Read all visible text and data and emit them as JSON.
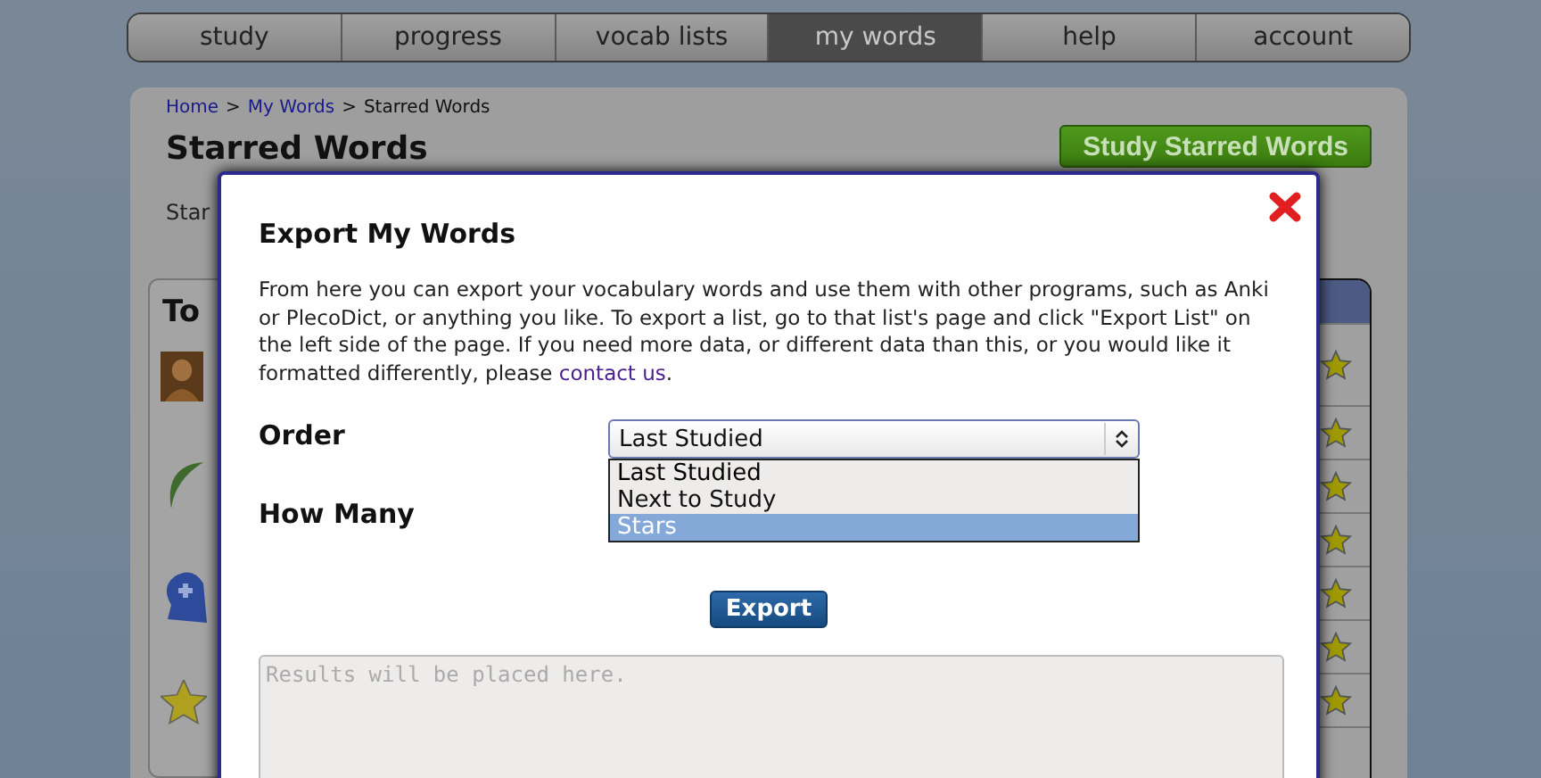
{
  "nav": [
    {
      "label": "study",
      "selected": false
    },
    {
      "label": "progress",
      "selected": false
    },
    {
      "label": "vocab lists",
      "selected": false
    },
    {
      "label": "my words",
      "selected": true
    },
    {
      "label": "help",
      "selected": false
    },
    {
      "label": "account",
      "selected": false
    }
  ],
  "breadcrumb": {
    "separator": ">",
    "items": [
      {
        "label": "Home",
        "kind": "link"
      },
      {
        "label": "My Words",
        "kind": "link"
      },
      {
        "label": "Starred Words",
        "kind": "current"
      }
    ]
  },
  "page": {
    "title": "Starred Words",
    "study_button": "Study Starred Words",
    "intro": "Star"
  },
  "top_card": {
    "title": "To"
  },
  "modal": {
    "title": "Export My Words",
    "text": "From here you can export your vocabulary words and use them with other programs, such as Anki or PlecoDict, or anything you like. To export a list, go to that list's page and click \"Export List\" on the left side of the page. If you need more data, or different data than this, or you would like it formatted differently, please ",
    "link": "contact us",
    "text_end": ".",
    "order": {
      "label": "Order",
      "value": "Last Studied",
      "expanded": true,
      "options": [
        {
          "label": "Last Studied",
          "selected": true,
          "highlighted": false
        },
        {
          "label": "Next to Study",
          "selected": false,
          "highlighted": false
        },
        {
          "label": "Stars",
          "selected": false,
          "highlighted": true
        }
      ]
    },
    "how_many": {
      "label": "How Many"
    },
    "export_button": "Export",
    "results": {
      "placeholder": "Results will be placed here."
    }
  }
}
